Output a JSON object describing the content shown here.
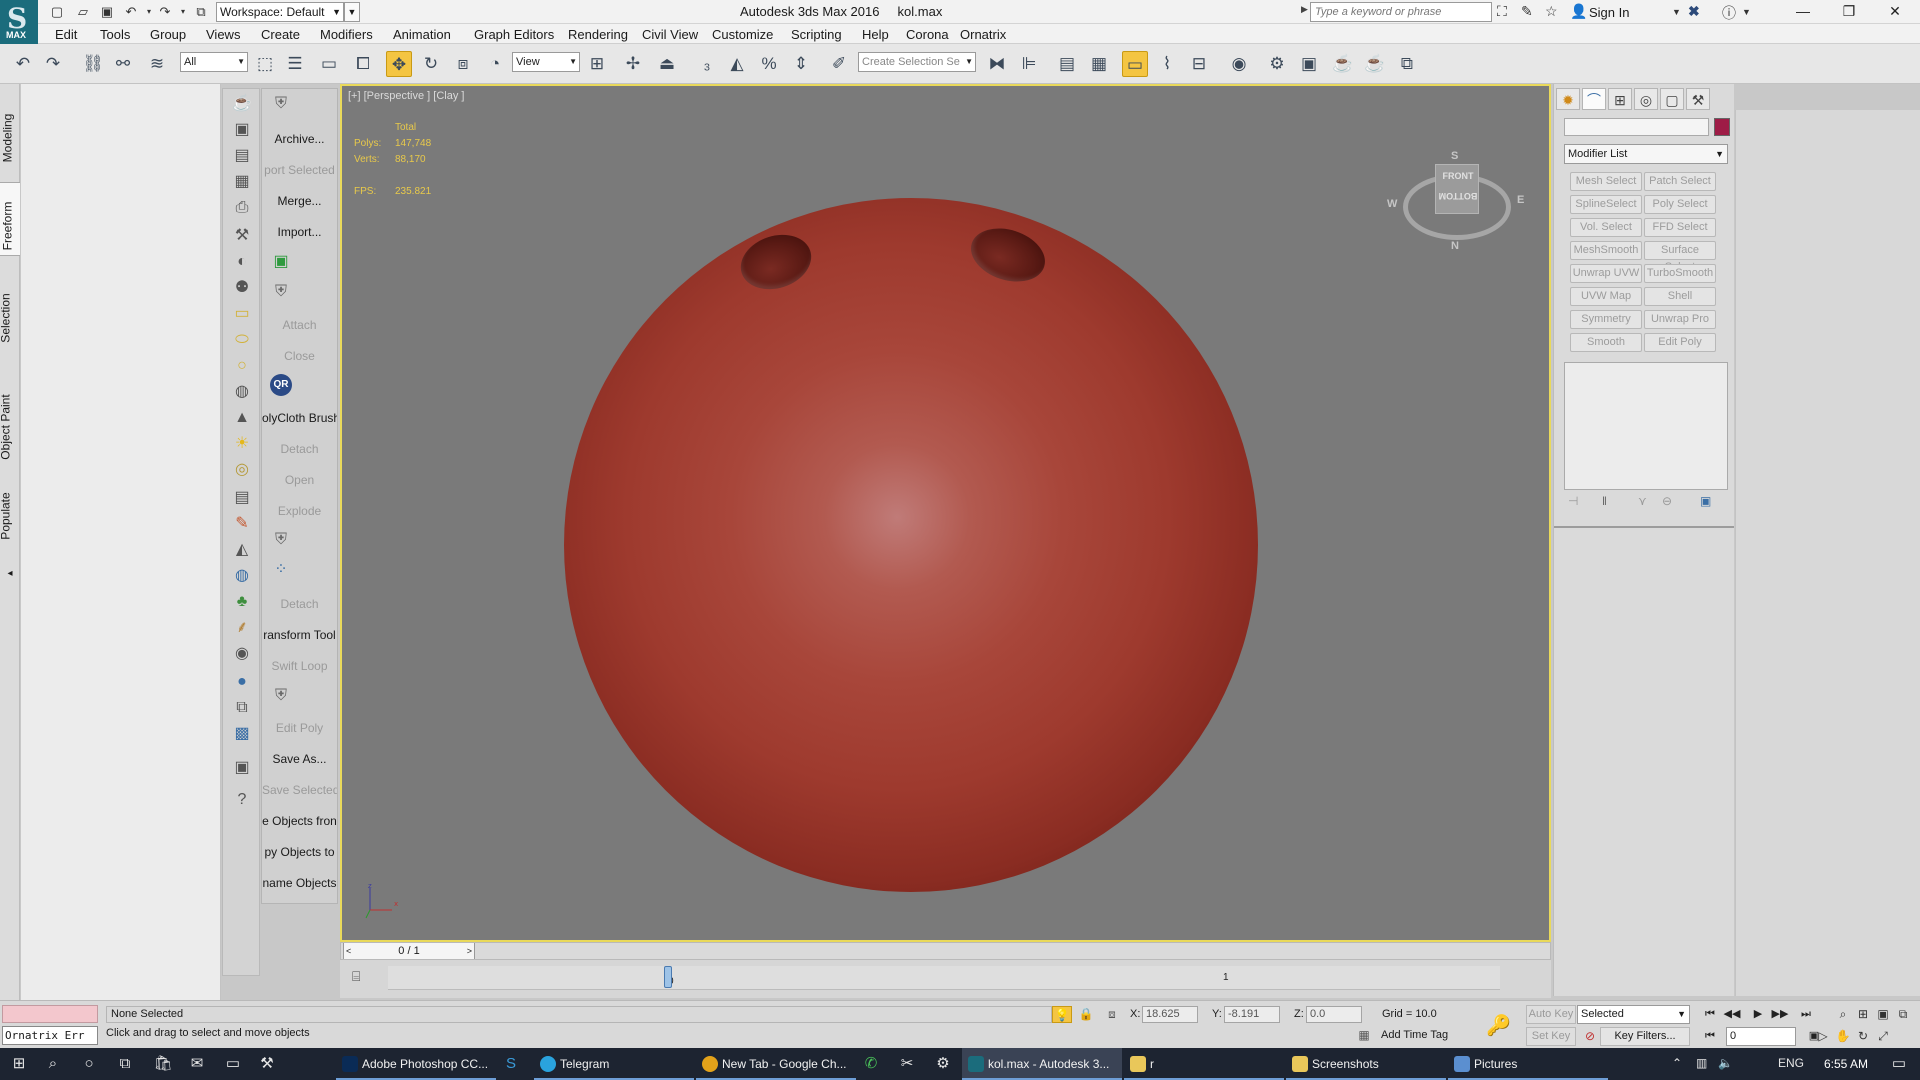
{
  "window": {
    "title": "Autodesk 3ds Max 2016",
    "filename": "kol.max",
    "logo_text": "MAX",
    "workspace_label": "Workspace: Default",
    "search_placeholder": "Type a keyword or phrase",
    "sign_in": "Sign In"
  },
  "menu": [
    "Edit",
    "Tools",
    "Group",
    "Views",
    "Create",
    "Modifiers",
    "Animation",
    "Graph Editors",
    "Rendering",
    "Civil View",
    "Customize",
    "Scripting",
    "Help",
    "Corona",
    "Ornatrix"
  ],
  "toolbar": {
    "filter_value": "All",
    "ref_coord_value": "View",
    "selection_set_placeholder": "Create Selection Se"
  },
  "command_tabs": [
    "Modeling",
    "Freeform",
    "Selection",
    "Object Paint",
    "Populate"
  ],
  "script_panel": {
    "buttons": [
      {
        "label": "Archive...",
        "disabled": false
      },
      {
        "label": "port Selected",
        "disabled": true
      },
      {
        "label": "Merge...",
        "disabled": false
      },
      {
        "label": "Import...",
        "disabled": false
      },
      {
        "label": "Attach",
        "disabled": true
      },
      {
        "label": "Close",
        "disabled": true
      },
      {
        "label": "olyCloth Brush",
        "disabled": false
      },
      {
        "label": "Detach",
        "disabled": true
      },
      {
        "label": "Open",
        "disabled": true
      },
      {
        "label": "Explode",
        "disabled": true
      },
      {
        "label": "Detach",
        "disabled": true
      },
      {
        "label": "ransform Tool",
        "disabled": false
      },
      {
        "label": "Swift Loop",
        "disabled": true
      },
      {
        "label": "Edit Poly",
        "disabled": true
      },
      {
        "label": "Save As...",
        "disabled": false
      },
      {
        "label": "Save Selected",
        "disabled": true
      },
      {
        "label": "e Objects fron",
        "disabled": false
      },
      {
        "label": "py Objects to",
        "disabled": false
      },
      {
        "label": "name Objects",
        "disabled": false
      }
    ],
    "qr_label": "QR"
  },
  "viewport": {
    "label": "[+] [Perspective ] [Clay ]",
    "stats_header": "Total",
    "polys_label": "Polys:",
    "polys_value": "147,748",
    "verts_label": "Verts:",
    "verts_value": "88,170",
    "fps_label": "FPS:",
    "fps_value": "235.821",
    "viewcube": {
      "front": "FRONT",
      "bottom": "BOTTOM",
      "north": "N",
      "south": "S",
      "east": "E",
      "west": "W"
    }
  },
  "timeline": {
    "frame_display": "0 / 1",
    "ruler_marks": [
      "0",
      "1"
    ]
  },
  "command_panel": {
    "modifier_list": "Modifier List",
    "modifier_buttons": [
      [
        "Mesh Select",
        "Patch Select"
      ],
      [
        "SplineSelect",
        "Poly Select"
      ],
      [
        "Vol. Select",
        "FFD Select"
      ],
      [
        "MeshSmooth",
        "Surface Select"
      ],
      [
        "Unwrap UVW",
        "TurboSmooth"
      ],
      [
        "UVW Map",
        "Shell"
      ],
      [
        "Symmetry",
        "Unwrap Pro"
      ],
      [
        "Smooth",
        "Edit Poly"
      ]
    ],
    "object_color": "#9e1c46"
  },
  "status": {
    "ornatrix_field": "Ornatrix Err",
    "selection": "None Selected",
    "prompt": "Click and drag to select and move objects",
    "x_label": "X:",
    "x_value": "18.625",
    "y_label": "Y:",
    "y_value": "-8.191",
    "z_label": "Z:",
    "z_value": "0.0",
    "grid": "Grid = 10.0",
    "add_time_tag": "Add Time Tag",
    "auto_key": "Auto Key",
    "set_key": "Set Key",
    "selected_dd": "Selected",
    "key_filters": "Key Filters...",
    "frame": "0"
  },
  "taskbar": {
    "apps": [
      {
        "label": "Adobe Photoshop CC...",
        "color": "#0a2b56"
      },
      {
        "label": "Telegram",
        "color": "#2aa3de"
      },
      {
        "label": "New Tab - Google Ch...",
        "color": "#e3a21a"
      },
      {
        "label": "kol.max - Autodesk 3...",
        "color": "#1b6c7c"
      },
      {
        "label": "r",
        "color": "#e9c75a"
      },
      {
        "label": "Screenshots",
        "color": "#e9c75a"
      },
      {
        "label": "Pictures",
        "color": "#5b8fd0"
      }
    ],
    "lang": "ENG",
    "time": "6:55 AM"
  }
}
